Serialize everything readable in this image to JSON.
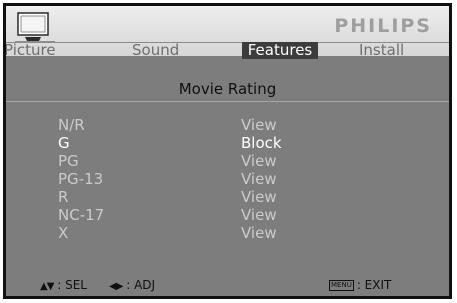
{
  "header": {
    "brand": "PHILIPS",
    "icon": "tv-icon"
  },
  "tabs": [
    {
      "label": "Picture"
    },
    {
      "label": "Sound"
    },
    {
      "label": "Features",
      "active": true
    },
    {
      "label": "Install"
    }
  ],
  "screen": {
    "title": "Movie Rating",
    "rows": [
      {
        "name": "N/R",
        "value": "View"
      },
      {
        "name": "G",
        "value": "Block",
        "selected": true
      },
      {
        "name": "PG",
        "value": "View"
      },
      {
        "name": "PG-13",
        "value": "View"
      },
      {
        "name": "R",
        "value": "View"
      },
      {
        "name": "NC-17",
        "value": "View"
      },
      {
        "name": "X",
        "value": "View"
      }
    ]
  },
  "footer": {
    "sel_label": ": SEL",
    "adj_label": ": ADJ",
    "menu_key": "MENU",
    "exit_label": ": EXIT",
    "updown_icon": "up-down-arrows-icon",
    "leftright_icon": "left-right-arrows-icon"
  },
  "colors": {
    "background": "#7d7d7d",
    "header": "#e6e6e6",
    "active_tab": "#3c3c3c",
    "text_inactive": "#cbcbcb",
    "text_selected": "#ffffff"
  }
}
